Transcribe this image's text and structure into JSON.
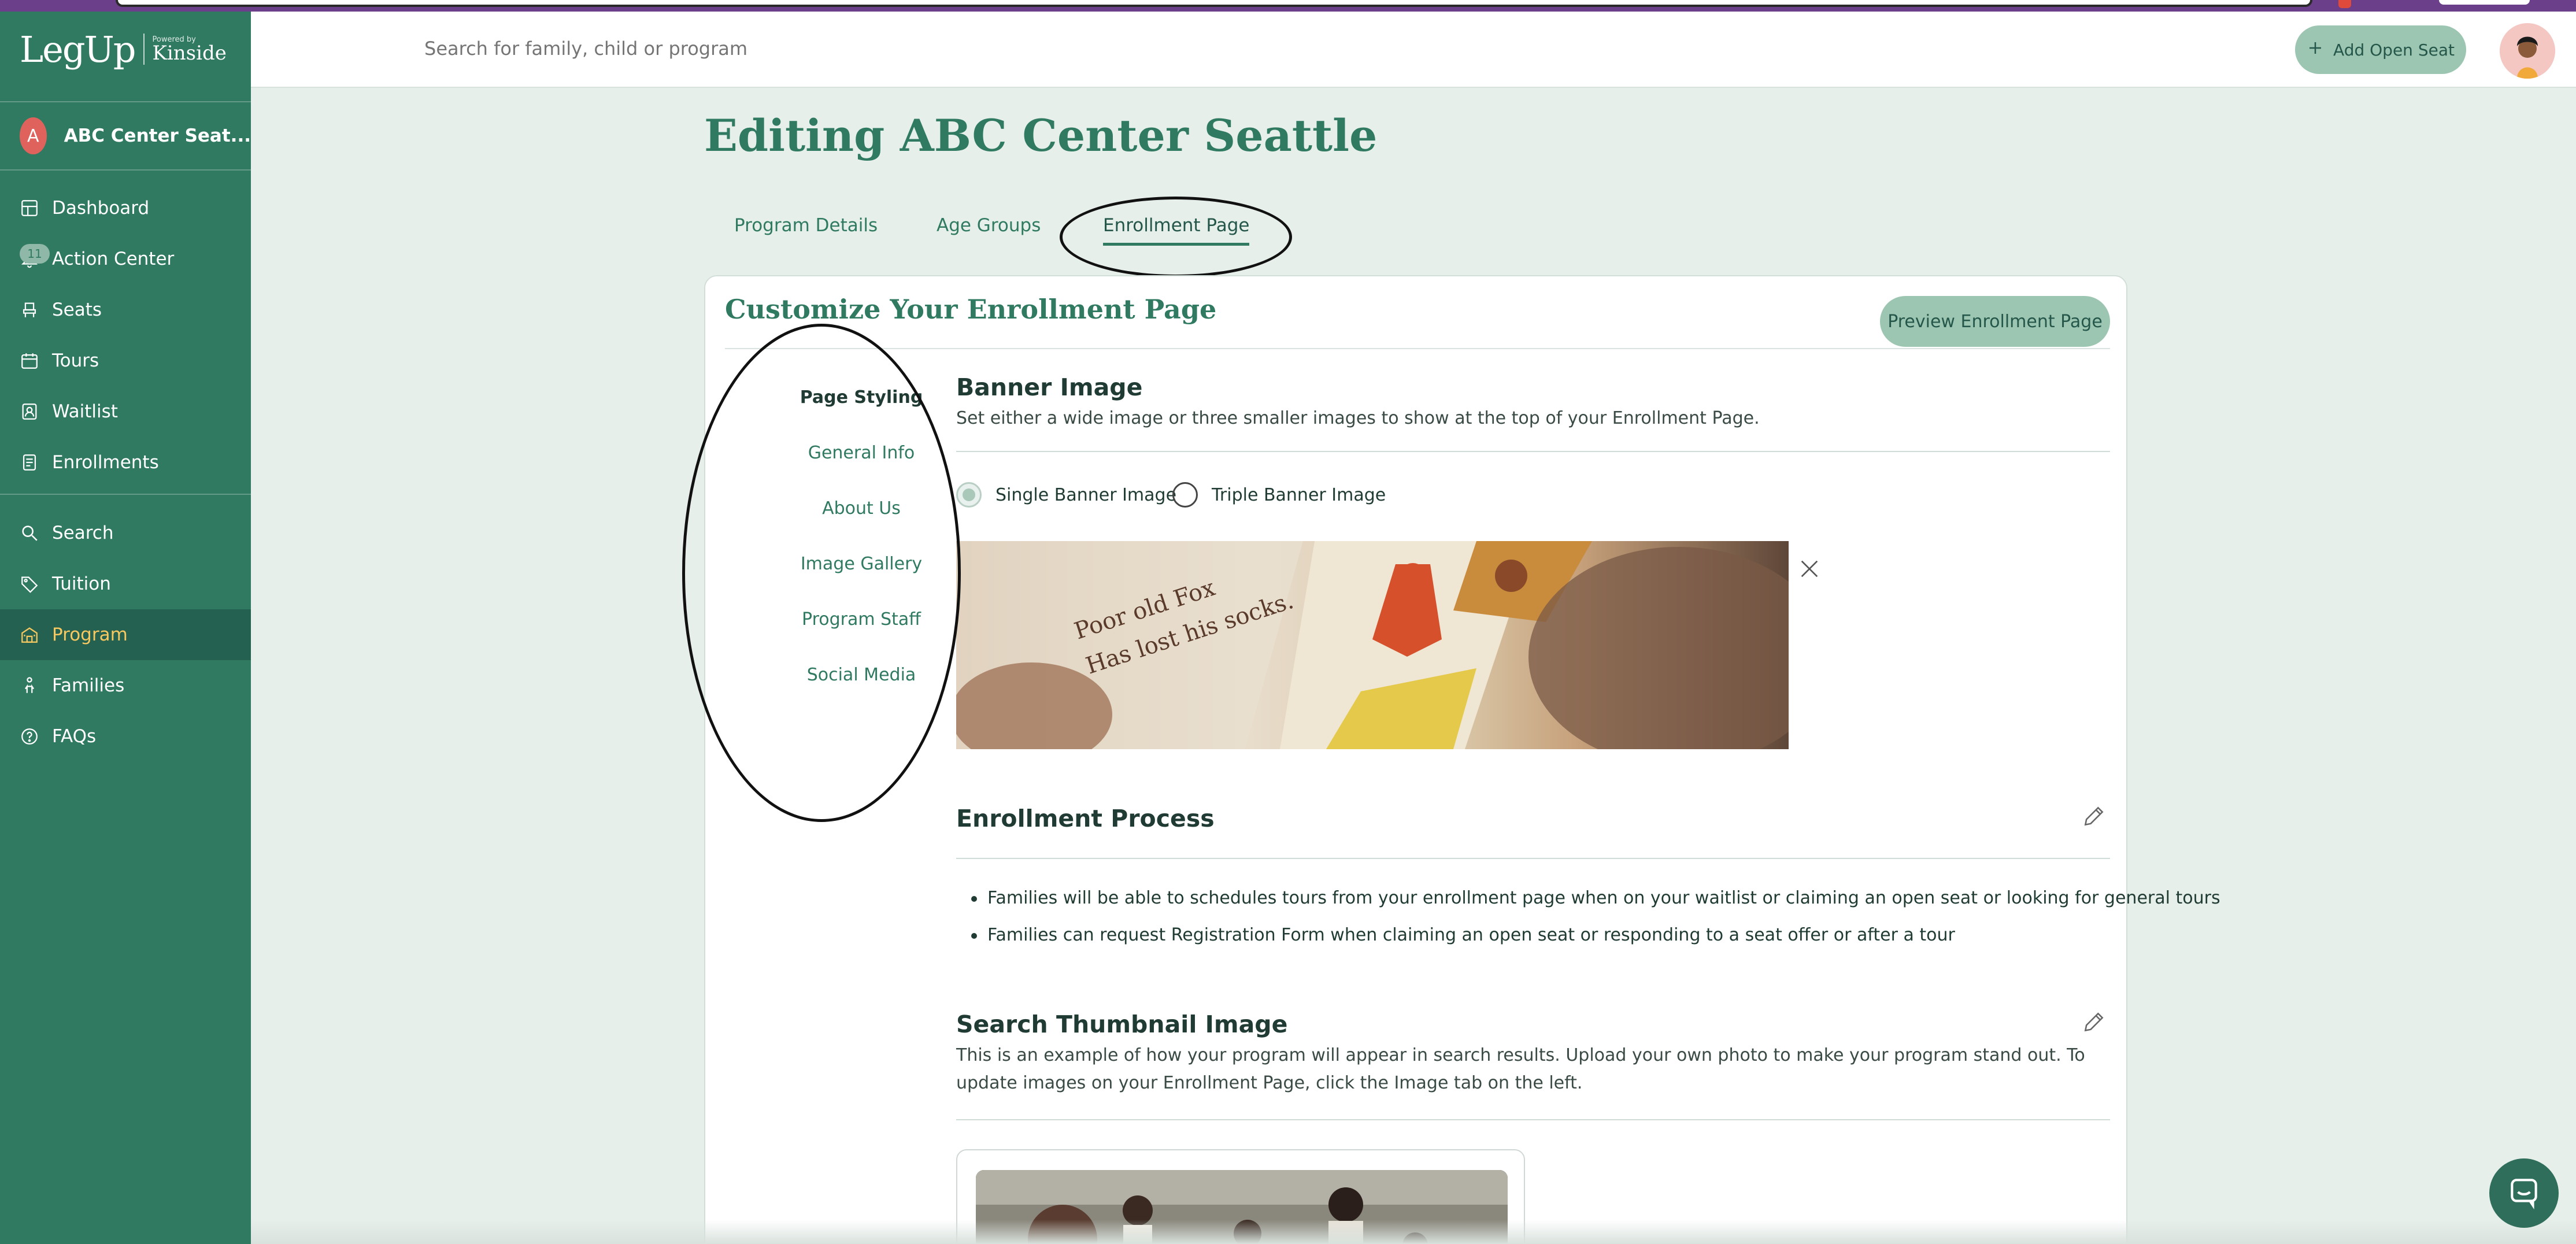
{
  "colors": {
    "brand": "#2f7a61",
    "sidebar_active": "#246150",
    "active_text": "#f6c85f",
    "button_bg": "#9cc6b2",
    "avatar_a": "#e0625d"
  },
  "logo": {
    "main": "LegUp",
    "powered": "Powered by",
    "brand": "Kinside"
  },
  "account": {
    "initial": "A",
    "name": "ABC Center Seat..."
  },
  "sidebar": {
    "primary": [
      {
        "label": "Dashboard",
        "icon": "grid-icon"
      },
      {
        "label": "Action Center",
        "icon": "bell-icon",
        "badge": "11"
      },
      {
        "label": "Seats",
        "icon": "seat-icon"
      },
      {
        "label": "Tours",
        "icon": "calendar-icon"
      },
      {
        "label": "Waitlist",
        "icon": "clipboard-user-icon"
      },
      {
        "label": "Enrollments",
        "icon": "document-icon"
      }
    ],
    "secondary": [
      {
        "label": "Search",
        "icon": "search-icon"
      },
      {
        "label": "Tuition",
        "icon": "tag-icon"
      },
      {
        "label": "Program",
        "icon": "building-icon",
        "active": true
      },
      {
        "label": "Families",
        "icon": "person-icon"
      },
      {
        "label": "FAQs",
        "icon": "question-icon"
      }
    ]
  },
  "header": {
    "search_placeholder": "Search for family, child or program",
    "add_seat_label": "Add Open Seat"
  },
  "page": {
    "title": "Editing ABC Center Seattle",
    "tabs": [
      {
        "label": "Program Details"
      },
      {
        "label": "Age Groups"
      },
      {
        "label": "Enrollment Page",
        "active": true
      }
    ]
  },
  "card": {
    "title": "Customize Your Enrollment Page",
    "preview_label": "Preview Enrollment Page",
    "subnav": [
      {
        "label": "Page Styling",
        "active": true
      },
      {
        "label": "General Info"
      },
      {
        "label": "About Us"
      },
      {
        "label": "Image Gallery"
      },
      {
        "label": "Program Staff"
      },
      {
        "label": "Social Media"
      }
    ],
    "banner": {
      "heading": "Banner Image",
      "description": "Set either a wide image or three smaller images to show at the top of your Enrollment Page.",
      "options": [
        {
          "label": "Single Banner Image",
          "selected": true
        },
        {
          "label": "Triple Banner Image",
          "selected": false
        }
      ],
      "image_text_line1": "Poor old Fox",
      "image_text_line2": "Has lost his socks."
    },
    "enrollment": {
      "heading": "Enrollment Process",
      "bullets": [
        "Families will be able to schedules tours from your enrollment page when on your waitlist or claiming an open seat or looking for general tours",
        "Families can request Registration Form when claiming an open seat or responding to a seat offer or after a tour"
      ]
    },
    "thumbnail": {
      "heading": "Search Thumbnail Image",
      "description_line1": "This is an example of how your program will appear in search results. Upload your own photo to make your program stand out. To",
      "description_line2": "update images on your Enrollment Page, click the Image tab on the left."
    }
  }
}
